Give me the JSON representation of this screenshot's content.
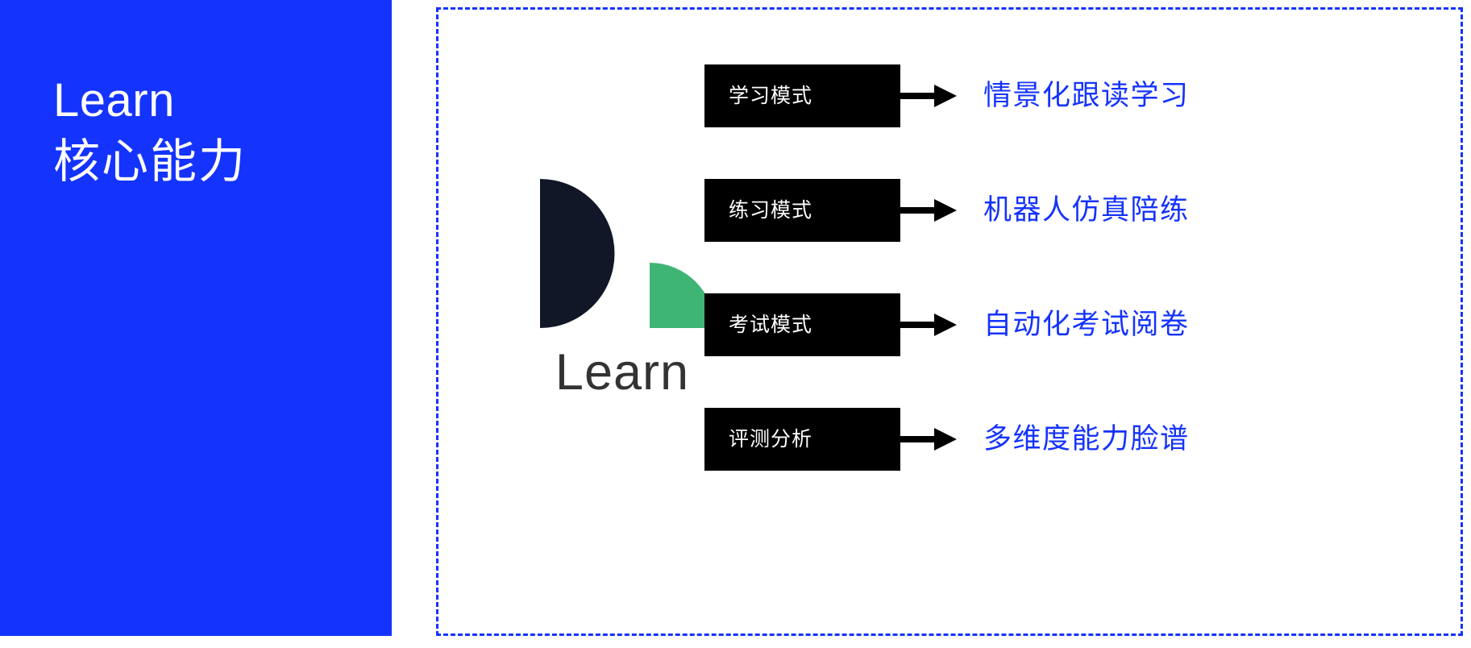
{
  "slide": {
    "background_color": "#ffffff",
    "accent_blue": "#1433fd",
    "box_black": "#000000",
    "logo_dark": "#121728",
    "logo_green": "#3fb573",
    "wordmark_gray": "#333333"
  },
  "title_panel": {
    "background_color": "#1433fd",
    "line_en": "Learn",
    "line_cn": "核心能力"
  },
  "logo": {
    "mark_name": "learn-logo-mark",
    "dark_shape": "half-disc",
    "accent_shape": "quarter-disc",
    "wordmark": "Learn"
  },
  "flow_rows": [
    {
      "mode": "学习模式",
      "arrow": "arrow-right-icon",
      "outcome": "情景化跟读学习"
    },
    {
      "mode": "练习模式",
      "arrow": "arrow-right-icon",
      "outcome": "机器人仿真陪练"
    },
    {
      "mode": "考试模式",
      "arrow": "arrow-right-icon",
      "outcome": "自动化考试阅卷"
    },
    {
      "mode": "评测分析",
      "arrow": "arrow-right-icon",
      "outcome": "多维度能力脸谱"
    }
  ]
}
